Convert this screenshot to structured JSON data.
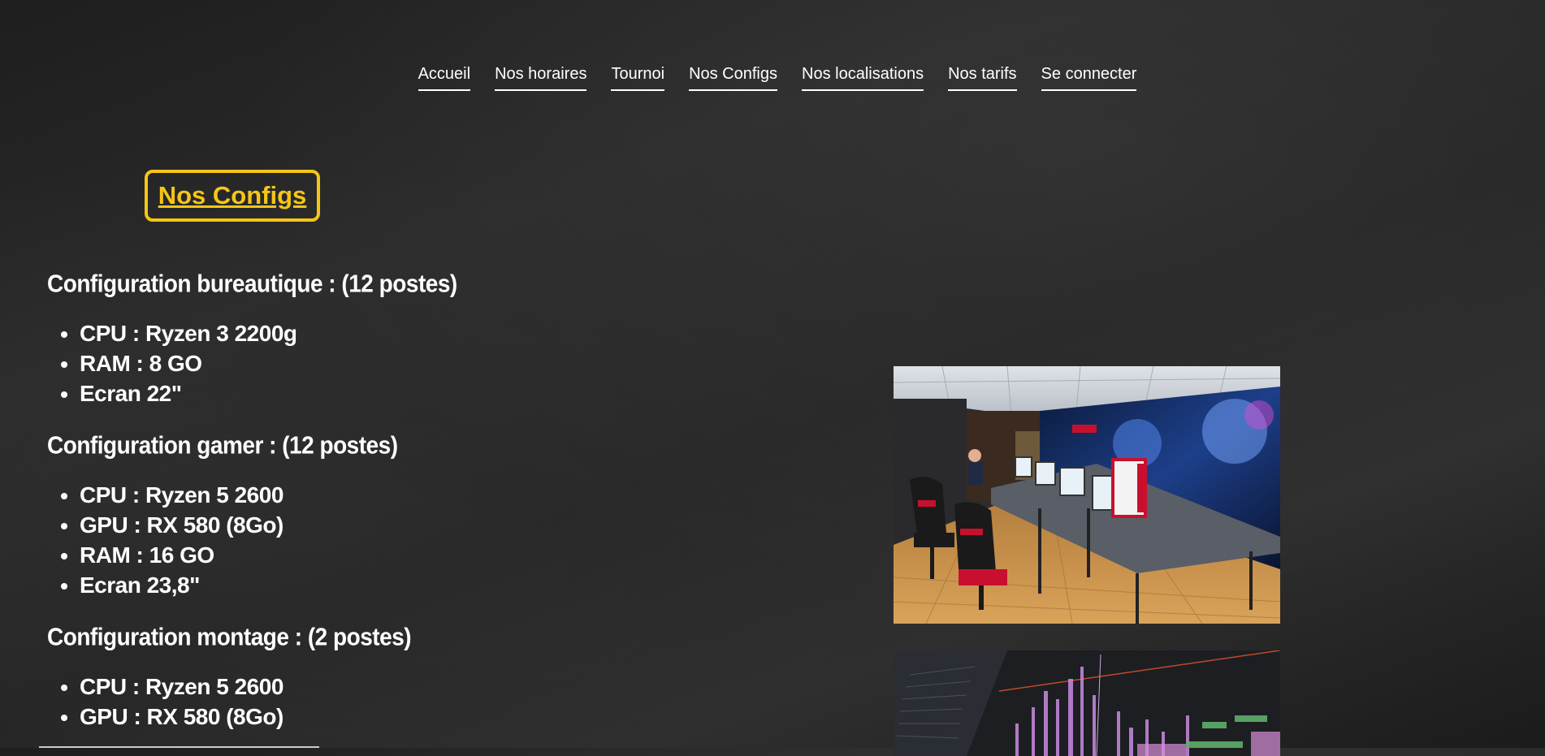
{
  "nav": [
    {
      "label": "Accueil"
    },
    {
      "label": "Nos horaires"
    },
    {
      "label": "Tournoi"
    },
    {
      "label": "Nos Configs"
    },
    {
      "label": "Nos localisations"
    },
    {
      "label": "Nos tarifs"
    },
    {
      "label": "Se connecter"
    }
  ],
  "page_title": "Nos Configs",
  "sections": [
    {
      "heading": "Configuration bureautique : (12 postes)",
      "items": [
        "CPU : Ryzen 3 2200g",
        "RAM : 8 GO",
        "Ecran 22\""
      ]
    },
    {
      "heading": "Configuration gamer : (12 postes)",
      "items": [
        "CPU : Ryzen 5 2600",
        "GPU : RX 580 (8Go)",
        "RAM : 16 GO",
        "Ecran 23,8\""
      ]
    },
    {
      "heading": "Configuration montage : (2 postes)",
      "items": [
        "CPU : Ryzen 5 2600",
        "GPU : RX 580 (8Go)"
      ]
    }
  ],
  "colors": {
    "accent": "#f5c518",
    "text": "#ffffff"
  }
}
